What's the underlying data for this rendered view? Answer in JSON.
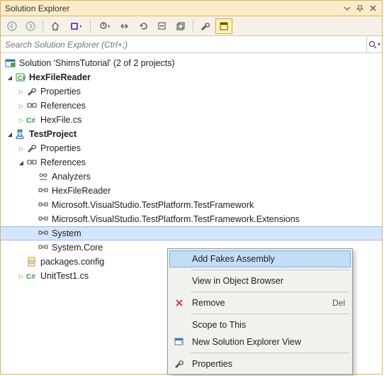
{
  "title": "Solution Explorer",
  "search": {
    "placeholder": "Search Solution Explorer (Ctrl+;)"
  },
  "tree": {
    "root_label": "Solution 'ShimsTutorial' (2 of 2 projects)",
    "proj1": {
      "name": "HexFileReader",
      "properties": "Properties",
      "references": "References",
      "file1": "HexFile.cs"
    },
    "proj2": {
      "name": "TestProject",
      "properties": "Properties",
      "references": "References",
      "refs_children": {
        "analyzers": "Analyzers",
        "r1": "HexFileReader",
        "r2": "Microsoft.VisualStudio.TestPlatform.TestFramework",
        "r3": "Microsoft.VisualStudio.TestPlatform.TestFramework.Extensions",
        "r4": "System",
        "r5": "System.Core"
      },
      "packages": "packages.config",
      "unit": "UnitTest1.cs"
    }
  },
  "context_menu": {
    "fakes": "Add Fakes Assembly",
    "view_obj": "View in Object Browser",
    "remove": "Remove",
    "remove_shortcut": "Del",
    "scope": "Scope to This",
    "newview": "New Solution Explorer View",
    "props": "Properties"
  }
}
